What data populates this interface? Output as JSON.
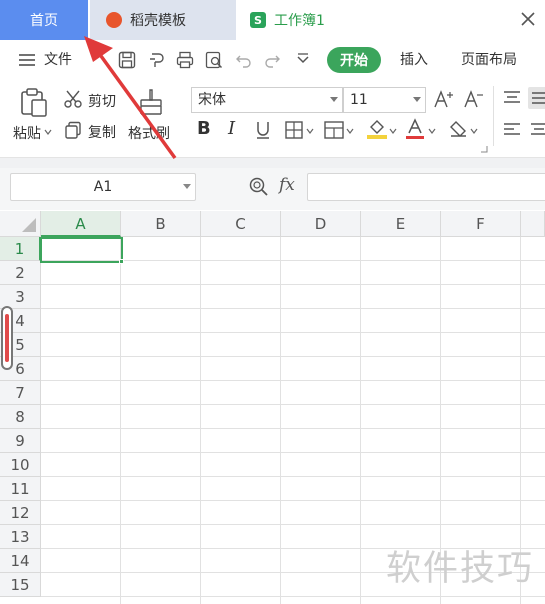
{
  "tabs": {
    "home": "首页",
    "template": "稻壳模板",
    "workbook": "工作簿1"
  },
  "menu": {
    "file": "文件",
    "start": "开始",
    "insert": "插入",
    "page_layout": "页面布局"
  },
  "ribbon": {
    "paste": "粘贴",
    "cut": "剪切",
    "copy": "复制",
    "format_painter": "格式刷",
    "font_name": "宋体",
    "font_size": "11"
  },
  "formula_bar": {
    "cell_ref": "A1",
    "fx": "fx",
    "content": ""
  },
  "sheet": {
    "columns": [
      "A",
      "B",
      "C",
      "D",
      "E",
      "F"
    ],
    "rows": [
      "1",
      "2",
      "3",
      "4",
      "5",
      "6",
      "7",
      "8",
      "9",
      "10",
      "11",
      "12",
      "13",
      "14",
      "15"
    ],
    "selected_cell": "A1"
  },
  "watermark": "软件技巧",
  "colors": {
    "home_tab": "#5b8def",
    "accent_green": "#3ba55c",
    "annotation_arrow": "#e03a3a"
  }
}
